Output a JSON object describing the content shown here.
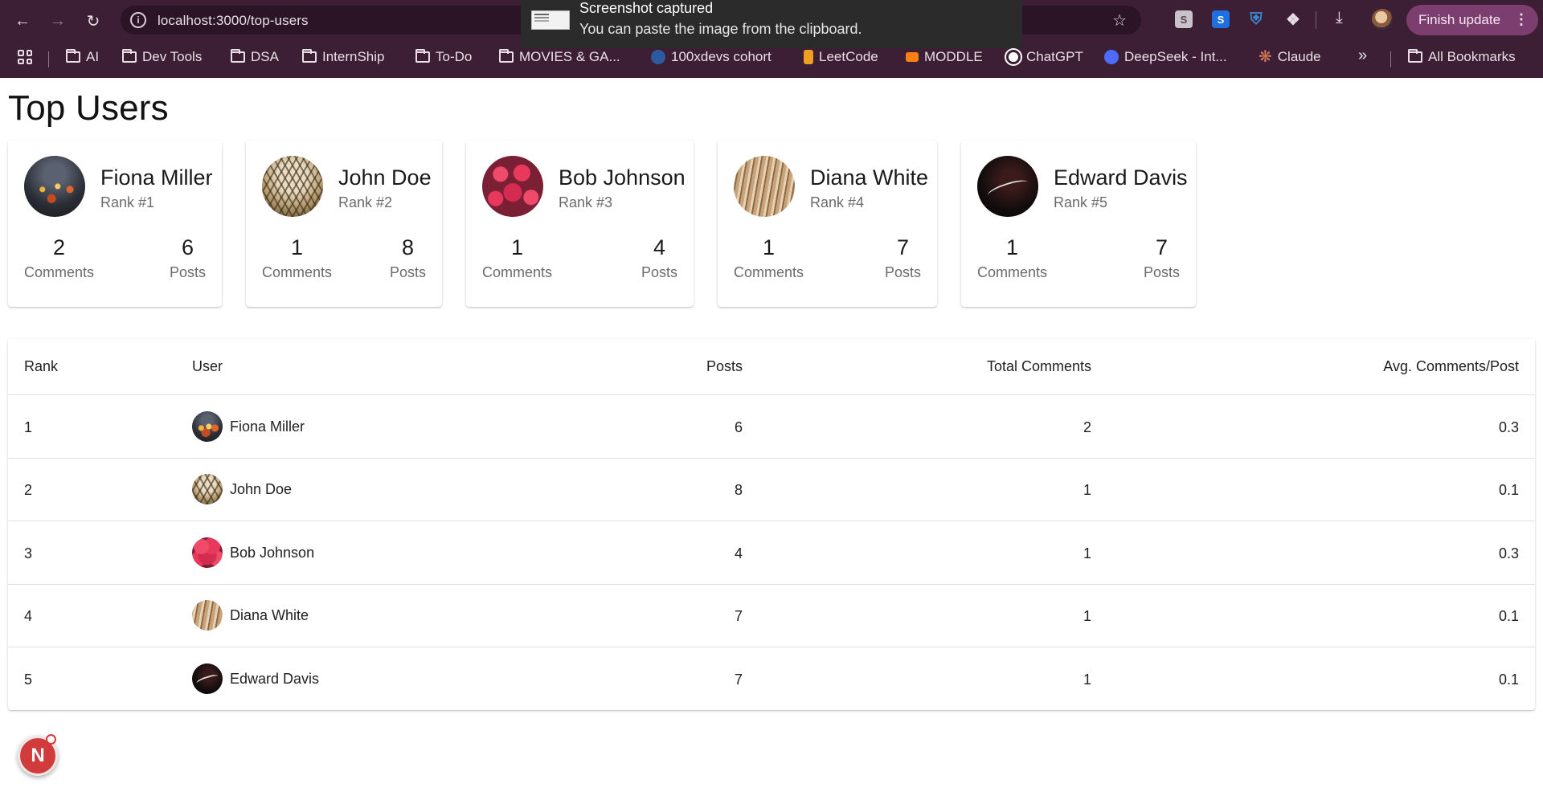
{
  "browser": {
    "url": "localhost:3000/top-users",
    "finish_update_label": "Finish update",
    "toast": {
      "title": "Screenshot captured",
      "body": "You can paste the image from the clipboard."
    },
    "bookmarks": [
      {
        "label": "AI",
        "icon": "folder-icon"
      },
      {
        "label": "Dev Tools",
        "icon": "folder-icon"
      },
      {
        "label": "DSA",
        "icon": "folder-icon"
      },
      {
        "label": "InternShip",
        "icon": "folder-icon"
      },
      {
        "label": "To-Do",
        "icon": "folder-icon"
      },
      {
        "label": "MOVIES & GA...",
        "icon": "folder-icon"
      },
      {
        "label": "100xdevs cohort",
        "icon": "site-icon"
      },
      {
        "label": "LeetCode",
        "icon": "leetcode-icon"
      },
      {
        "label": "MODDLE",
        "icon": "moodle-icon"
      },
      {
        "label": "ChatGPT",
        "icon": "chatgpt-icon"
      },
      {
        "label": "DeepSeek - Int...",
        "icon": "deepseek-icon"
      },
      {
        "label": "Claude",
        "icon": "claude-icon"
      }
    ],
    "all_bookmarks_label": "All Bookmarks"
  },
  "page": {
    "title": "Top Users",
    "cards": [
      {
        "name": "Fiona Miller",
        "rank": "Rank #1",
        "comments": "2",
        "comments_label": "Comments",
        "posts": "6",
        "posts_label": "Posts"
      },
      {
        "name": "John Doe",
        "rank": "Rank #2",
        "comments": "1",
        "comments_label": "Comments",
        "posts": "8",
        "posts_label": "Posts"
      },
      {
        "name": "Bob Johnson",
        "rank": "Rank #3",
        "comments": "1",
        "comments_label": "Comments",
        "posts": "4",
        "posts_label": "Posts"
      },
      {
        "name": "Diana White",
        "rank": "Rank #4",
        "comments": "1",
        "comments_label": "Comments",
        "posts": "7",
        "posts_label": "Posts"
      },
      {
        "name": "Edward Davis",
        "rank": "Rank #5",
        "comments": "1",
        "comments_label": "Comments",
        "posts": "7",
        "posts_label": "Posts"
      }
    ],
    "table": {
      "headers": {
        "rank": "Rank",
        "user": "User",
        "posts": "Posts",
        "total_comments": "Total Comments",
        "avg": "Avg. Comments/Post"
      },
      "rows": [
        {
          "rank": "1",
          "user": "Fiona Miller",
          "posts": "6",
          "total_comments": "2",
          "avg": "0.3"
        },
        {
          "rank": "2",
          "user": "John Doe",
          "posts": "8",
          "total_comments": "1",
          "avg": "0.1"
        },
        {
          "rank": "3",
          "user": "Bob Johnson",
          "posts": "4",
          "total_comments": "1",
          "avg": "0.3"
        },
        {
          "rank": "4",
          "user": "Diana White",
          "posts": "7",
          "total_comments": "1",
          "avg": "0.1"
        },
        {
          "rank": "5",
          "user": "Edward Davis",
          "posts": "7",
          "total_comments": "1",
          "avg": "0.1"
        }
      ]
    },
    "next_badge_label": "N"
  }
}
